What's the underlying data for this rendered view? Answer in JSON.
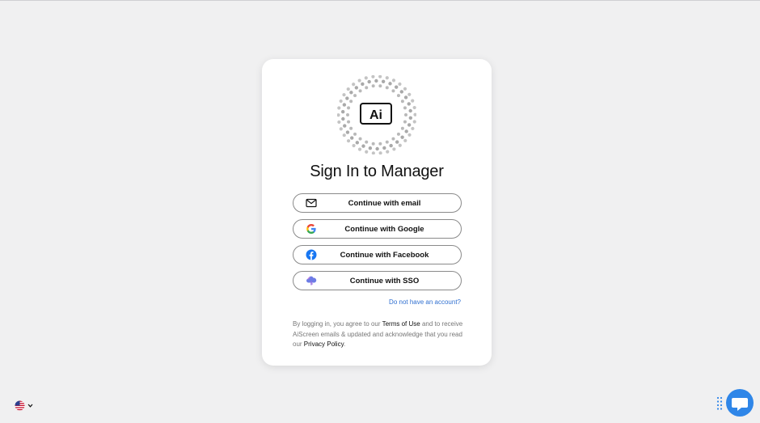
{
  "brand": {
    "logo_text": "Ai"
  },
  "signin": {
    "title": "Sign In to Manager",
    "buttons": {
      "email": "Continue with email",
      "google": "Continue with Google",
      "facebook": "Continue with Facebook",
      "sso": "Continue with SSO"
    },
    "signup_link": "Do not have an account?",
    "legal": {
      "part1": "By logging in, you agree to our ",
      "terms": "Terms of Use",
      "part2": " and to receive AiScreen emails & updated and acknowledge that you read our ",
      "privacy": "Privacy Policy",
      "part3": "."
    }
  },
  "footer": {
    "language_icon": "us-flag-icon",
    "chat_icon": "chat-bubble-icon"
  },
  "colors": {
    "background": "#f0f0f1",
    "link": "#2f6fd0",
    "chat": "#2f86e8",
    "facebook": "#1877f2"
  }
}
